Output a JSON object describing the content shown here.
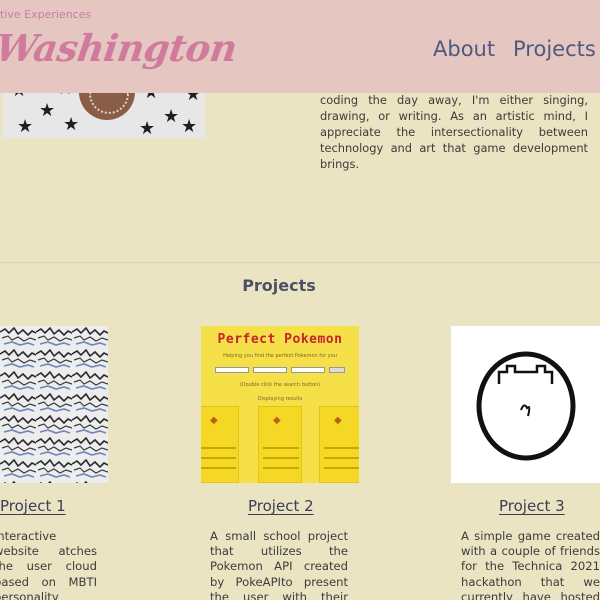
{
  "header": {
    "tagline": "tive Experiences",
    "logo_text": "Washington",
    "nav": {
      "about": "About",
      "projects": "Projects"
    }
  },
  "about": {
    "paragraph": "design, and UI/UX design. When I'm not coding the day away, I'm either singing, drawing, or writing. As an artistic mind, I appreciate the intersectionality between technology and art that game development brings."
  },
  "projects": {
    "section_title": "Projects",
    "items": [
      {
        "title": "Project 1",
        "description": "interactive website atches the user cloud based on MBTI personality Created as a"
      },
      {
        "title": "Project 2",
        "description": "A small school project that utilizes the Pokemon API created by PokeAPIto present the user with their \"perfect Pokemon\"",
        "thumb": {
          "title": "Perfect Pokemon",
          "subtitle": "Helping you find the perfect Pokemon for you",
          "hint": "(Double click the search button)",
          "displaying": "Displaying results"
        }
      },
      {
        "title": "Project 3",
        "description": "A simple game created with a couple of friends for the Technica 2021 hackathon that we currently have hosted on"
      }
    ]
  },
  "colors": {
    "background": "#ebe4c2",
    "header": "#e5c6c1",
    "logo": "#d07a9d",
    "nav": "#4e5a80"
  }
}
